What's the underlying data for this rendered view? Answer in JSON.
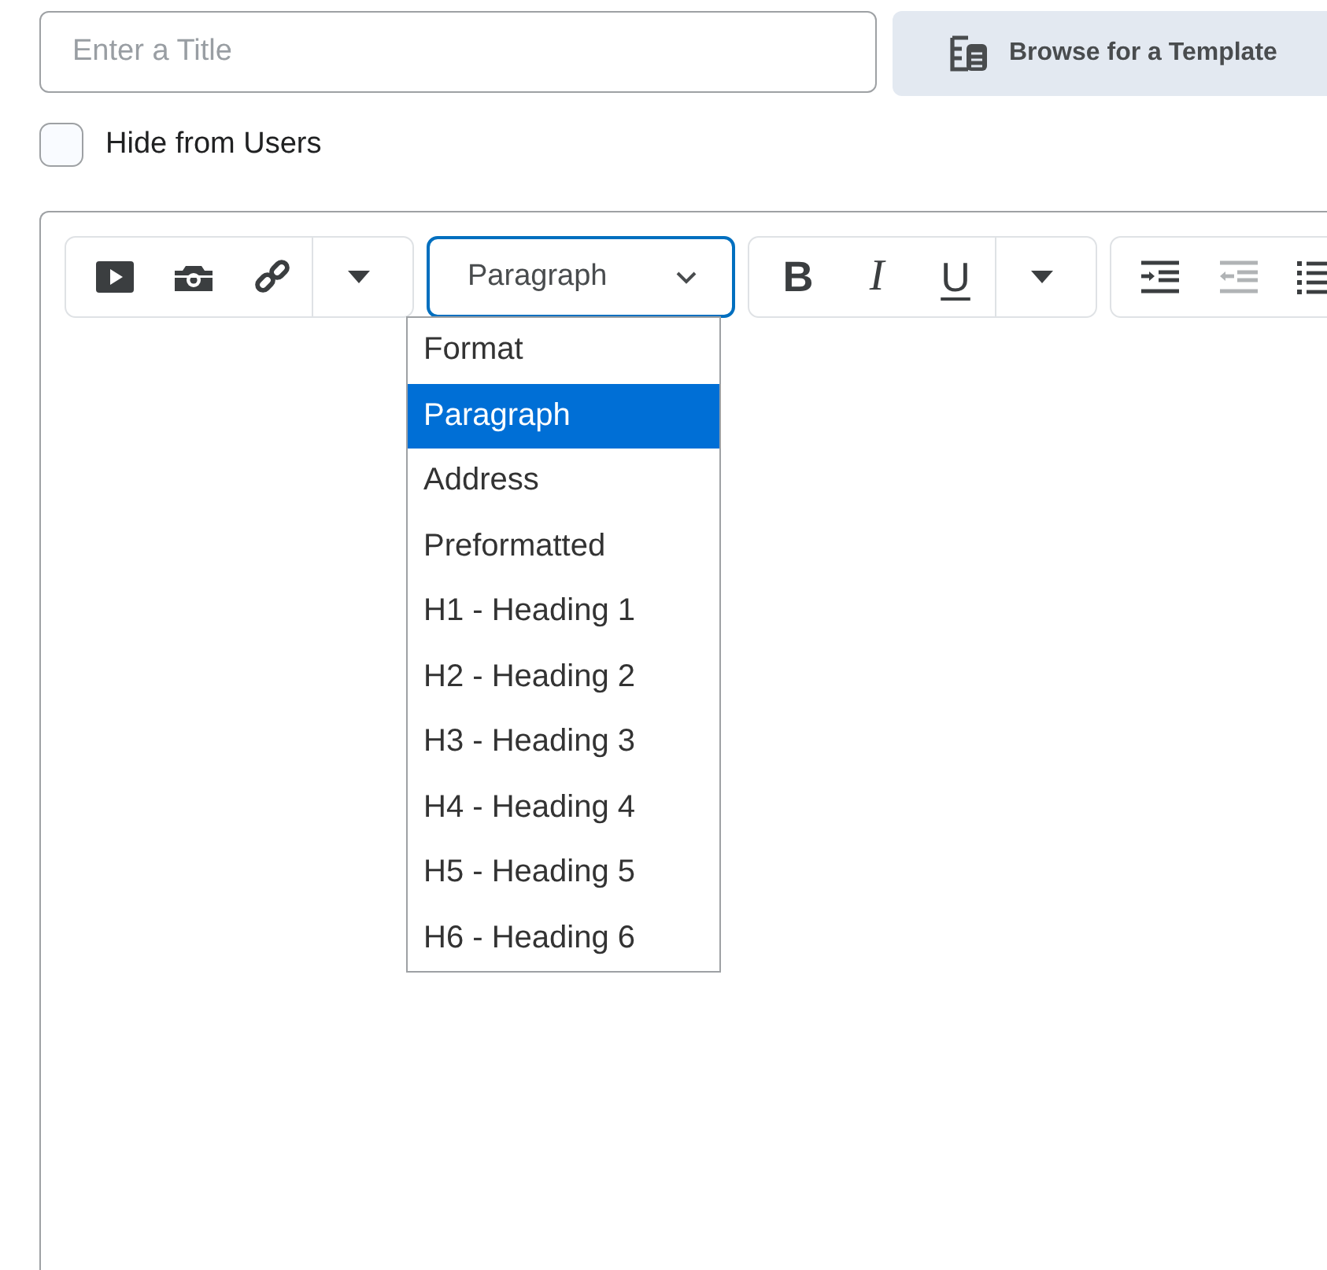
{
  "title_field": {
    "placeholder": "Enter a Title"
  },
  "template_button": {
    "label": "Browse for a Template"
  },
  "hide_from_users": {
    "label": "Hide from Users",
    "checked": false
  },
  "toolbar": {
    "groups": [
      {
        "buttons": [
          {
            "kind": "video",
            "disabled": false
          },
          {
            "kind": "camera",
            "disabled": false
          },
          {
            "kind": "link",
            "disabled": false
          },
          {
            "kind": "more",
            "disabled": false
          }
        ]
      },
      {
        "kind": "select",
        "value": "Paragraph"
      },
      {
        "buttons": [
          {
            "kind": "bold",
            "label": "B",
            "disabled": false
          },
          {
            "kind": "italic",
            "label": "I",
            "disabled": false
          },
          {
            "kind": "underline",
            "label": "U",
            "disabled": false
          },
          {
            "kind": "more",
            "disabled": false
          }
        ]
      },
      {
        "buttons": [
          {
            "kind": "indent",
            "disabled": false
          },
          {
            "kind": "outdent",
            "disabled": true
          },
          {
            "kind": "list",
            "disabled": false
          }
        ]
      }
    ]
  },
  "format_menu": {
    "items": [
      {
        "label": "Format",
        "selected": false
      },
      {
        "label": "Paragraph",
        "selected": true
      },
      {
        "label": "Address",
        "selected": false
      },
      {
        "label": "Preformatted",
        "selected": false
      },
      {
        "label": "H1 - Heading 1",
        "selected": false
      },
      {
        "label": "H2 - Heading 2",
        "selected": false
      },
      {
        "label": "H3 - Heading 3",
        "selected": false
      },
      {
        "label": "H4 - Heading 4",
        "selected": false
      },
      {
        "label": "H5 - Heading 5",
        "selected": false
      },
      {
        "label": "H6 - Heading 6",
        "selected": false
      }
    ]
  }
}
